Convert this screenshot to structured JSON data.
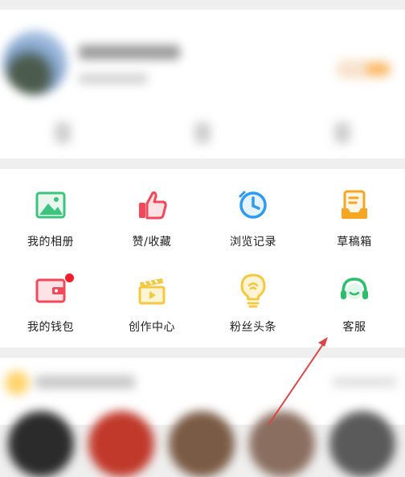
{
  "menu": {
    "items": [
      {
        "label": "我的相册",
        "icon": "photo-album-icon",
        "badge": false
      },
      {
        "label": "赞/收藏",
        "icon": "thumbs-up-icon",
        "badge": false
      },
      {
        "label": "浏览记录",
        "icon": "clock-history-icon",
        "badge": false
      },
      {
        "label": "草稿箱",
        "icon": "draft-box-icon",
        "badge": false
      },
      {
        "label": "我的钱包",
        "icon": "wallet-icon",
        "badge": true
      },
      {
        "label": "创作中心",
        "icon": "clapperboard-icon",
        "badge": false
      },
      {
        "label": "粉丝头条",
        "icon": "lightbulb-icon",
        "badge": false
      },
      {
        "label": "客服",
        "icon": "headset-icon",
        "badge": false
      }
    ]
  },
  "colors": {
    "album": "#3bc47d",
    "like": "#f1485a",
    "history": "#2f9bf0",
    "draft": "#f5a623",
    "wallet": "#f1485a",
    "creator": "#f5c842",
    "fans": "#f5c842",
    "service": "#2bbf6b",
    "badge": "#f01d2a",
    "annotation_arrow": "#d94545"
  }
}
